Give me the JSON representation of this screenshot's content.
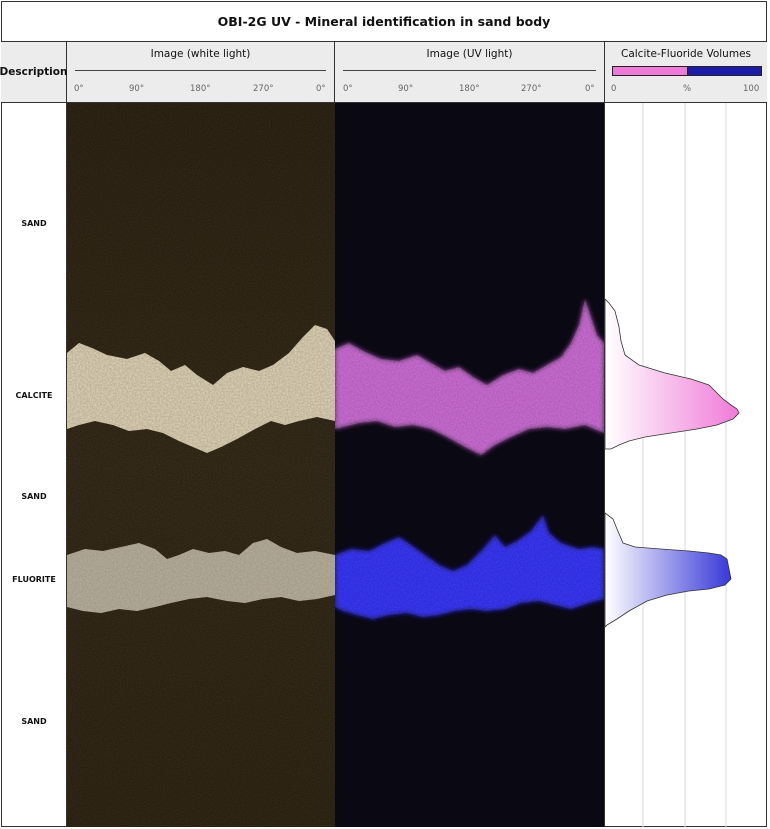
{
  "title": "OBI-2G UV - Mineral identification in sand body",
  "header": {
    "description": "Description",
    "image_white": "Image (white light)",
    "image_uv": "Image (UV light)",
    "volumes": "Calcite-Fluoride Volumes",
    "volume_scale": {
      "min": "0",
      "unit": "%",
      "max": "100"
    }
  },
  "azimuth_ticks": [
    "0°",
    "90°",
    "180°",
    "270°",
    "0°"
  ],
  "descriptions": [
    "SAND",
    "CALCITE",
    "SAND",
    "FLUORITE",
    "SAND"
  ],
  "colors": {
    "sand": "#3f321d",
    "calcite_white": "#e8dfc6",
    "fluorite_white": "#b8b2a3",
    "uv_background": "#0a0812",
    "calcite_uv": "#d46ad8",
    "fluorite_uv": "#2020e8",
    "calcite_volume": "#f07ad8",
    "fluorite_volume": "#1c1ca8"
  }
}
